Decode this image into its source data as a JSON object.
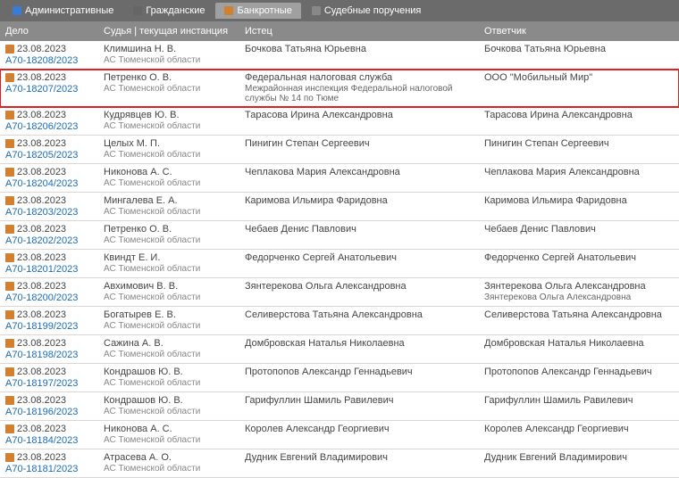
{
  "tabs": [
    {
      "label": "Административные",
      "icon": "ticon-a",
      "active": false
    },
    {
      "label": "Гражданские",
      "icon": "ticon-g",
      "active": false
    },
    {
      "label": "Банкротные",
      "icon": "ticon-b",
      "active": true
    },
    {
      "label": "Судебные поручения",
      "icon": "ticon-s",
      "active": false
    }
  ],
  "headers": {
    "case": "Дело",
    "judge": "Судья | текущая инстанция",
    "plaintiff": "Истец",
    "defendant": "Ответчик"
  },
  "court": "АС Тюменской области",
  "rows": [
    {
      "date": "23.08.2023",
      "num": "А70-18208/2023",
      "judge": "Климшина Н. В.",
      "plaintiff": "Бочкова Татьяна Юрьевна",
      "defendant": "Бочкова Татьяна Юрьевна",
      "highlighted": false
    },
    {
      "date": "23.08.2023",
      "num": "А70-18207/2023",
      "judge": "Петренко О. В.",
      "plaintiff": "Федеральная налоговая служба",
      "plaintiff2": "Межрайонная инспекция Федеральной налоговой службы № 14 по Тюме",
      "defendant": "ООО \"Мобильный Мир\"",
      "highlighted": true
    },
    {
      "date": "23.08.2023",
      "num": "А70-18206/2023",
      "judge": "Кудрявцев Ю. В.",
      "plaintiff": "Тарасова Ирина Александровна",
      "defendant": "Тарасова Ирина Александровна",
      "highlighted": false
    },
    {
      "date": "23.08.2023",
      "num": "А70-18205/2023",
      "judge": "Целых М. П.",
      "plaintiff": "Пинигин Степан Сергеевич",
      "defendant": "Пинигин Степан Сергеевич",
      "highlighted": false
    },
    {
      "date": "23.08.2023",
      "num": "А70-18204/2023",
      "judge": "Никонова А. С.",
      "plaintiff": "Чеплакова Мария Александровна",
      "defendant": "Чеплакова Мария Александровна",
      "highlighted": false
    },
    {
      "date": "23.08.2023",
      "num": "А70-18203/2023",
      "judge": "Мингалева Е. А.",
      "plaintiff": "Каримова Ильмира Фаридовна",
      "defendant": "Каримова Ильмира Фаридовна",
      "highlighted": false
    },
    {
      "date": "23.08.2023",
      "num": "А70-18202/2023",
      "judge": "Петренко О. В.",
      "plaintiff": "Чебаев Денис Павлович",
      "defendant": "Чебаев Денис Павлович",
      "highlighted": false
    },
    {
      "date": "23.08.2023",
      "num": "А70-18201/2023",
      "judge": "Квиндт Е. И.",
      "plaintiff": "Федорченко Сергей Анатольевич",
      "defendant": "Федорченко Сергей Анатольевич",
      "highlighted": false
    },
    {
      "date": "23.08.2023",
      "num": "А70-18200/2023",
      "judge": "Авхимович В. В.",
      "plaintiff": "Зянтерекова Ольга Александровна",
      "defendant": "Зянтерекова Ольга Александровна",
      "defendant2": "Зянтерекова Ольга Александровна",
      "highlighted": false
    },
    {
      "date": "23.08.2023",
      "num": "А70-18199/2023",
      "judge": "Богатырев Е. В.",
      "plaintiff": "Селиверстова Татьяна Александровна",
      "defendant": "Селиверстова Татьяна Александровна",
      "highlighted": false
    },
    {
      "date": "23.08.2023",
      "num": "А70-18198/2023",
      "judge": "Сажина А. В.",
      "plaintiff": "Домбровская Наталья Николаевна",
      "defendant": "Домбровская Наталья Николаевна",
      "highlighted": false
    },
    {
      "date": "23.08.2023",
      "num": "А70-18197/2023",
      "judge": "Кондрашов Ю. В.",
      "plaintiff": "Протопопов Александр Геннадьевич",
      "defendant": "Протопопов Александр Геннадьевич",
      "highlighted": false
    },
    {
      "date": "23.08.2023",
      "num": "А70-18196/2023",
      "judge": "Кондрашов Ю. В.",
      "plaintiff": "Гарифуллин Шамиль Равилевич",
      "defendant": "Гарифуллин Шамиль Равилевич",
      "highlighted": false
    },
    {
      "date": "23.08.2023",
      "num": "А70-18184/2023",
      "judge": "Никонова А. С.",
      "plaintiff": "Королев Александр Георгиевич",
      "defendant": "Королев Александр Георгиевич",
      "highlighted": false
    },
    {
      "date": "23.08.2023",
      "num": "А70-18181/2023",
      "judge": "Атрасева А. О.",
      "plaintiff": "Дудник Евгений Владимирович",
      "defendant": "Дудник Евгений Владимирович",
      "highlighted": false
    }
  ]
}
